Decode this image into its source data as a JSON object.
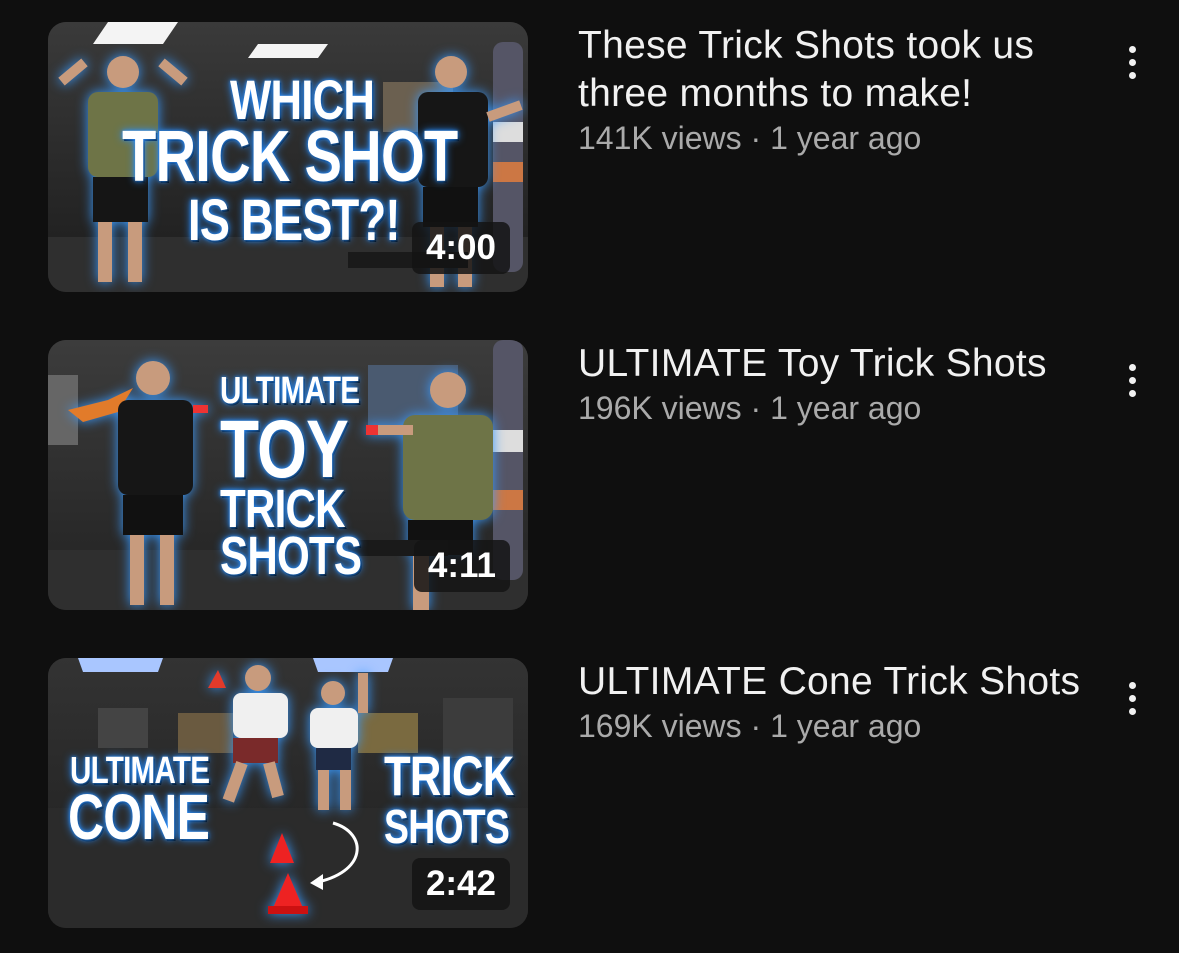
{
  "videos": [
    {
      "title": "These Trick Shots took us three months to make!",
      "views": "141K views",
      "age": "1 year ago",
      "duration": "4:00",
      "thumbnail_text": [
        "WHICH",
        "TRICK SHOT",
        "IS BEST?!"
      ]
    },
    {
      "title": "ULTIMATE Toy Trick Shots",
      "views": "196K views",
      "age": "1 year ago",
      "duration": "4:11",
      "thumbnail_text": [
        "ULTIMATE",
        "TOY",
        "TRICK",
        "SHOTS"
      ]
    },
    {
      "title": "ULTIMATE Cone Trick Shots",
      "views": "169K views",
      "age": "1 year ago",
      "duration": "2:42",
      "thumbnail_text": [
        "ULTIMATE",
        "CONE",
        "TRICK",
        "SHOTS"
      ]
    }
  ],
  "separator": "·",
  "menu_icon": "more-vertical-icon",
  "colors": {
    "background": "#0f0f0f",
    "title": "#f1f1f1",
    "meta": "#aaaaaa",
    "glow": "#2a8fff"
  }
}
